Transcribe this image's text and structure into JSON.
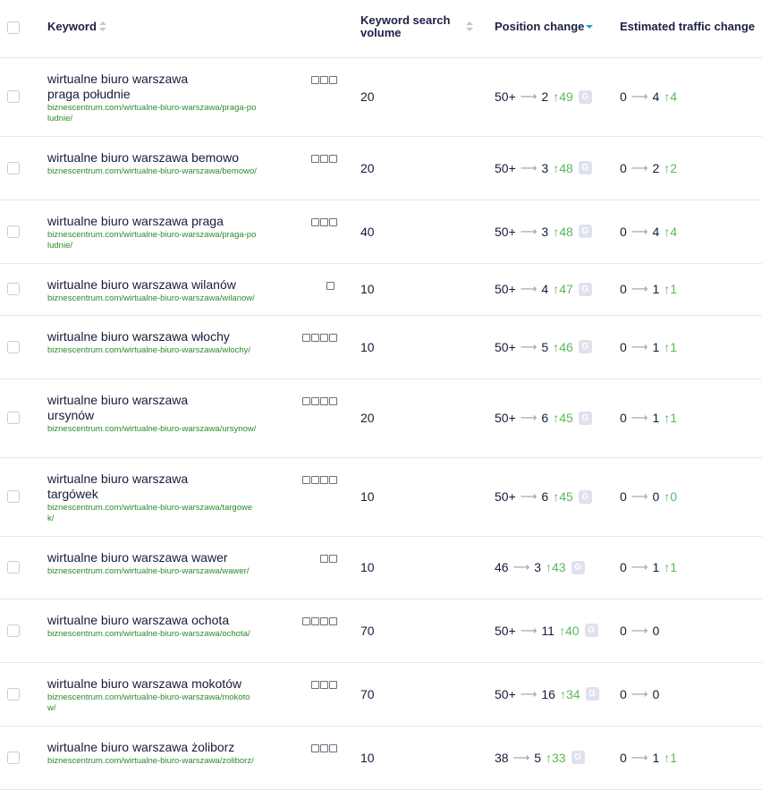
{
  "header": {
    "keyword": "Keyword",
    "volume": "Keyword search volume",
    "position": "Position change",
    "traffic": "Estimated traffic change"
  },
  "rows": [
    {
      "keyword": "wirtualne biuro warszawa praga południe",
      "url": "biznescentrum.com/wirtualne-biuro-warszawa/praga-poludnie/",
      "features": [
        "image-pack-icon",
        "local-pack-icon",
        "reviews-icon"
      ],
      "volume": "20",
      "pos_from": "50+",
      "pos_to": "2",
      "pos_delta": "49",
      "traffic_from": "0",
      "traffic_to": "4",
      "traffic_delta": "4"
    },
    {
      "keyword": "wirtualne biuro warszawa bemowo",
      "url": "biznescentrum.com/wirtualne-biuro-warszawa/bemowo/",
      "features": [
        "image-pack-icon",
        "local-pack-icon",
        "knowledge-panel-icon"
      ],
      "volume": "20",
      "pos_from": "50+",
      "pos_to": "3",
      "pos_delta": "48",
      "traffic_from": "0",
      "traffic_to": "2",
      "traffic_delta": "2"
    },
    {
      "keyword": "wirtualne biuro warszawa praga",
      "url": "biznescentrum.com/wirtualne-biuro-warszawa/praga-poludnie/",
      "features": [
        "image-pack-icon",
        "local-pack-icon",
        "knowledge-panel-icon"
      ],
      "volume": "40",
      "pos_from": "50+",
      "pos_to": "3",
      "pos_delta": "48",
      "traffic_from": "0",
      "traffic_to": "4",
      "traffic_delta": "4"
    },
    {
      "keyword": "wirtualne biuro warszawa wilanów",
      "url": "biznescentrum.com/wirtualne-biuro-warszawa/wilanow/",
      "features": [
        "image-pack-icon"
      ],
      "volume": "10",
      "pos_from": "50+",
      "pos_to": "4",
      "pos_delta": "47",
      "traffic_from": "0",
      "traffic_to": "1",
      "traffic_delta": "1"
    },
    {
      "keyword": "wirtualne biuro warszawa włochy",
      "url": "biznescentrum.com/wirtualne-biuro-warszawa/wlochy/",
      "features": [
        "image-pack-icon",
        "local-pack-icon",
        "reviews-icon",
        "knowledge-panel-icon"
      ],
      "volume": "10",
      "pos_from": "50+",
      "pos_to": "5",
      "pos_delta": "46",
      "traffic_from": "0",
      "traffic_to": "1",
      "traffic_delta": "1"
    },
    {
      "keyword": "wirtualne biuro warszawa ursynów",
      "url": "biznescentrum.com/wirtualne-biuro-warszawa/ursynow/",
      "features": [
        "image-pack-icon",
        "local-pack-icon",
        "reviews-icon",
        "knowledge-panel-icon"
      ],
      "volume": "20",
      "pos_from": "50+",
      "pos_to": "6",
      "pos_delta": "45",
      "traffic_from": "0",
      "traffic_to": "1",
      "traffic_delta": "1"
    },
    {
      "keyword": "wirtualne biuro warszawa targówek",
      "url": "biznescentrum.com/wirtualne-biuro-warszawa/targowek/",
      "features": [
        "image-pack-icon",
        "local-pack-icon",
        "reviews-icon",
        "knowledge-panel-icon"
      ],
      "volume": "10",
      "pos_from": "50+",
      "pos_to": "6",
      "pos_delta": "45",
      "traffic_from": "0",
      "traffic_to": "0",
      "traffic_delta": "0"
    },
    {
      "keyword": "wirtualne biuro warszawa wawer",
      "url": "biznescentrum.com/wirtualne-biuro-warszawa/wawer/",
      "features": [
        "image-pack-icon",
        "reviews-icon"
      ],
      "volume": "10",
      "pos_from": "46",
      "pos_to": "3",
      "pos_delta": "43",
      "traffic_from": "0",
      "traffic_to": "1",
      "traffic_delta": "1"
    },
    {
      "keyword": "wirtualne biuro warszawa ochota",
      "url": "biznescentrum.com/wirtualne-biuro-warszawa/ochota/",
      "features": [
        "image-pack-icon",
        "local-pack-icon",
        "reviews-icon",
        "knowledge-panel-icon"
      ],
      "volume": "70",
      "pos_from": "50+",
      "pos_to": "11",
      "pos_delta": "40",
      "traffic_from": "0",
      "traffic_to": "0",
      "traffic_delta": ""
    },
    {
      "keyword": "wirtualne biuro warszawa mokotów",
      "url": "biznescentrum.com/wirtualne-biuro-warszawa/mokotow/",
      "features": [
        "image-pack-icon",
        "local-pack-icon",
        "knowledge-panel-icon"
      ],
      "volume": "70",
      "pos_from": "50+",
      "pos_to": "16",
      "pos_delta": "34",
      "traffic_from": "0",
      "traffic_to": "0",
      "traffic_delta": ""
    },
    {
      "keyword": "wirtualne biuro warszawa żoliborz",
      "url": "biznescentrum.com/wirtualne-biuro-warszawa/zoliborz/",
      "features": [
        "image-pack-icon",
        "local-pack-icon",
        "knowledge-panel-icon"
      ],
      "volume": "10",
      "pos_from": "38",
      "pos_to": "5",
      "pos_delta": "33",
      "traffic_from": "0",
      "traffic_to": "1",
      "traffic_delta": "1"
    }
  ],
  "serp_badge": "G",
  "colors": {
    "accent": "#1aa3c7",
    "positive": "#5bb85b",
    "url": "#2c8a2c",
    "text": "#171c3a"
  }
}
